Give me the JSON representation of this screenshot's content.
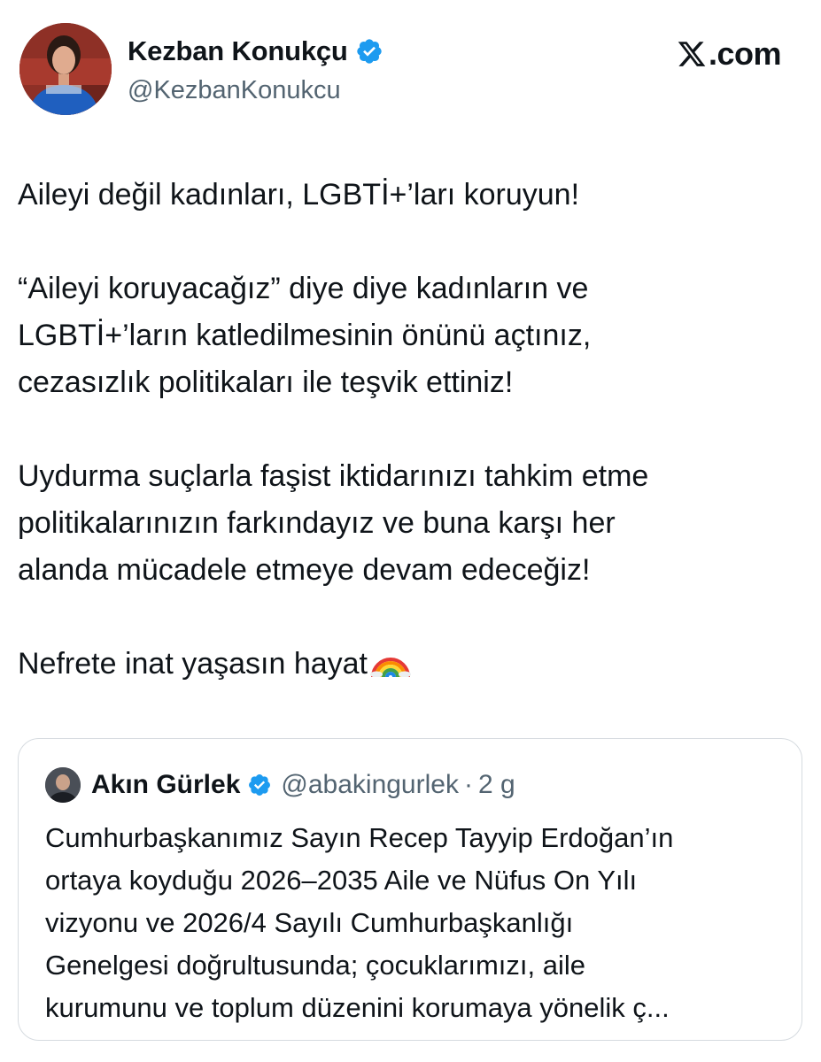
{
  "author": {
    "name": "Kezban Konukçu",
    "handle": "@KezbanKonukcu",
    "avatar_icon": "profile-photo",
    "verified_icon": "verified-badge-icon"
  },
  "brand": {
    "label": ".com",
    "icon": "x-logo-icon"
  },
  "tweet": {
    "paragraphs": [
      "Aileyi değil kadınları, LGBTİ+’ları koruyun!",
      "“Aileyi koruyacağız” diye diye kadınların ve\nLGBTİ+’ların katledilmesinin önünü açtınız,\ncezasızlık politikaları ile teşvik ettiniz!",
      "Uydurma suçlarla faşist iktidarınızı tahkim etme\npolitikalarınızın farkındayız ve buna karşı her\nalanda mücadele etmeye devam edeceğiz!",
      "Nefrete inat yaşasın hayat"
    ],
    "emoji": "rainbow-emoji"
  },
  "quoted": {
    "name": "Akın Gürlek",
    "handle": "@abakingurlek",
    "separator": "·",
    "time": "2 g",
    "lines": [
      "Cumhurbaşkanımız Sayın Recep Tayyip Erdoğan’ın",
      "ortaya koyduğu 2026–2035 Aile ve Nüfus On Yılı",
      "vizyonu ve 2026/4 Sayılı Cumhurbaşkanlığı",
      "Genelgesi doğrultusunda; çocuklarımızı, aile",
      "kurumunu ve toplum düzenini korumaya yönelik ç..."
    ]
  },
  "colors": {
    "text": "#0f1419",
    "secondary": "#536471",
    "verified": "#1d9bf0",
    "border": "#d6dbe0"
  }
}
